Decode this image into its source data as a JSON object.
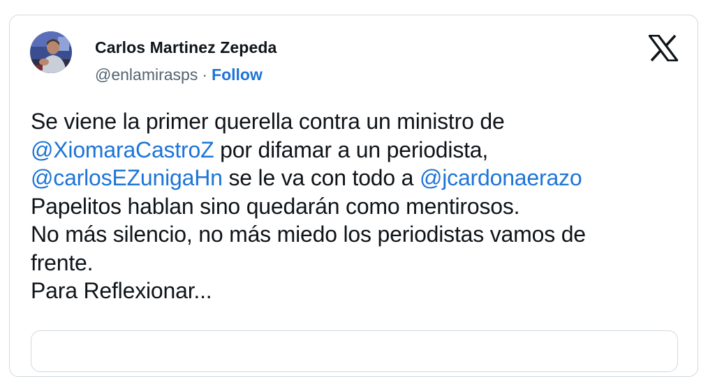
{
  "author": {
    "name": "Carlos Martinez Zepeda",
    "handle": "@enlamirasps",
    "separator": "·",
    "follow_label": "Follow"
  },
  "platform_icon": "x-logo-icon",
  "tweet": {
    "lines": [
      [
        {
          "text": "Se viene la primer querella contra un ministro de",
          "link": false
        }
      ],
      [
        {
          "text": "@XiomaraCastroZ",
          "link": true
        },
        {
          "text": " por difamar a un periodista,",
          "link": false
        }
      ],
      [
        {
          "text": "@carlosEZunigaHn",
          "link": true
        },
        {
          "text": " se le va con todo a ",
          "link": false
        },
        {
          "text": "@jcardonaerazo",
          "link": true
        }
      ],
      [
        {
          "text": "Papelitos hablan sino quedarán como mentirosos.",
          "link": false
        }
      ],
      [
        {
          "text": "No más silencio, no más miedo los periodistas vamos de",
          "link": false
        }
      ],
      [
        {
          "text": "frente.",
          "link": false
        }
      ],
      [
        {
          "text": "Para Reflexionar...",
          "link": false
        }
      ]
    ]
  },
  "colors": {
    "link": "#1d74d6",
    "muted": "#536471",
    "border": "#cfd9de",
    "text": "#0f1419"
  }
}
